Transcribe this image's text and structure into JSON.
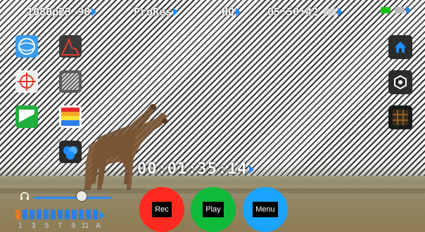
{
  "status_bar": {
    "resolution": "1080p23.98",
    "codec": "ProRes",
    "quality": "HQ",
    "time_remaining": "05:50:42"
  },
  "timecode": "00:01:35:14",
  "buttons": {
    "rec": "Rec",
    "play": "Play",
    "menu": "Menu"
  },
  "audio": {
    "volume_level": 0.62,
    "channel_labels": [
      "1",
      "3",
      "5",
      "7",
      "9",
      "11",
      "A"
    ]
  },
  "colors": {
    "accent": "#1e8cff",
    "rec": "#ff2a1f",
    "play": "#11b93a",
    "menu": "#1aa3ff",
    "battery": "#19c219"
  },
  "icons": {
    "left_column": [
      "waveform-icon",
      "target-icon",
      "flag-icon"
    ],
    "second_column": [
      "histogram-icon",
      "zebra-icon",
      "color-bars-icon",
      "false-color-icon"
    ],
    "right_column": [
      "home-icon",
      "settings-icon",
      "grid-icon"
    ]
  }
}
